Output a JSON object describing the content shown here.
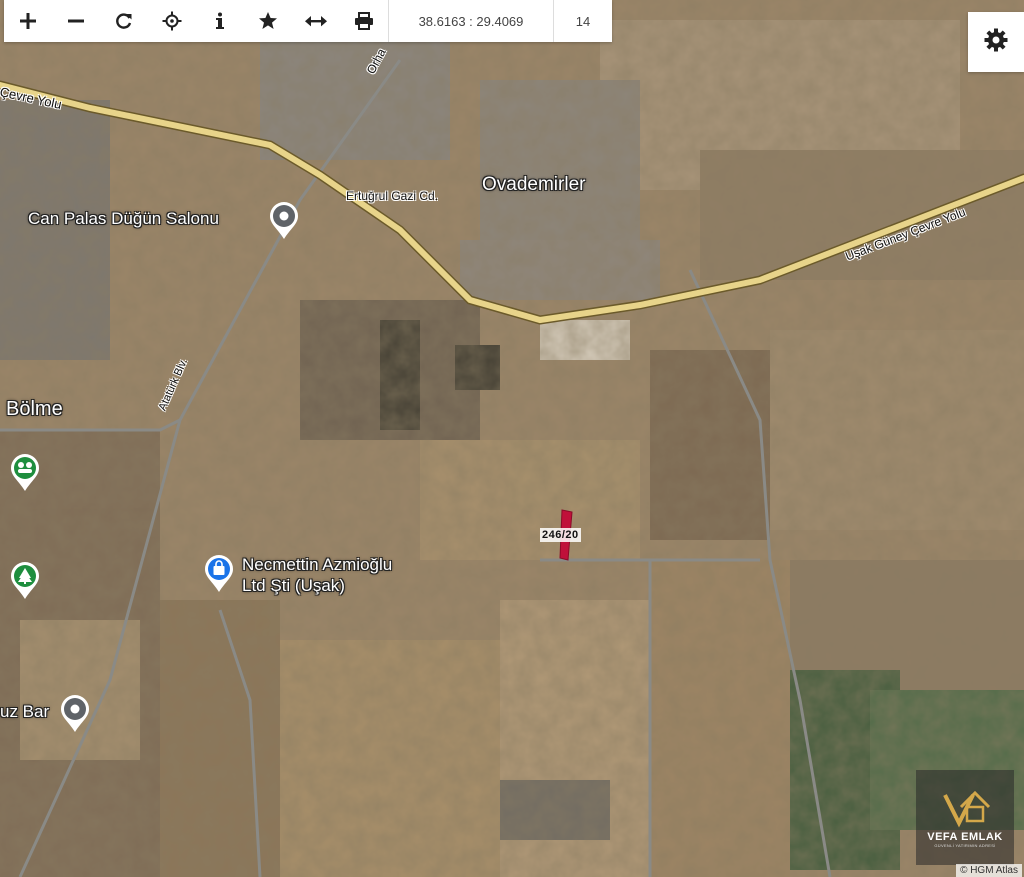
{
  "toolbar": {
    "buttons": [
      {
        "name": "zoom-in",
        "icon": "plus-icon"
      },
      {
        "name": "zoom-out",
        "icon": "minus-icon"
      },
      {
        "name": "refresh",
        "icon": "refresh-icon"
      },
      {
        "name": "locate",
        "icon": "crosshair-icon"
      },
      {
        "name": "info",
        "icon": "info-icon"
      },
      {
        "name": "favorite",
        "icon": "star-icon"
      },
      {
        "name": "measure",
        "icon": "arrows-horizontal-icon"
      },
      {
        "name": "print",
        "icon": "printer-icon"
      }
    ],
    "coordinates": "38.6163 : 29.4069",
    "zoom_level": "14"
  },
  "settings": {
    "icon": "gear-icon"
  },
  "labels": {
    "ovademirler": "Ovademirler",
    "bolme": "Bölme",
    "can_palas": "Can Palas Düğün Salonu",
    "necmettin_line1": "Necmettin Azmioğlu",
    "necmettin_line2": "Ltd Şti (Uşak)",
    "bar": "uz Bar"
  },
  "roads": {
    "cevre_yolu": "Çevre Yolu",
    "orha": "Orha",
    "ertugrul": "Ertuğrul Gazi Cd.",
    "usak_guney": "Uşak Güney Çevre Yolu",
    "ataturk": "Atatürk Blv."
  },
  "parcel": {
    "label": "246/20",
    "color": "#c0103a"
  },
  "watermark": {
    "name": "VEFA EMLAK",
    "tagline": "GÜVENLİ YATIRIMIN ADRESİ"
  },
  "attribution": "© HGM Atlas",
  "colors": {
    "road": "#e8d48a",
    "road_edge": "#6b5a2a",
    "pin": "#5f6368",
    "pin_green": "#1e8e3e",
    "pin_blue": "#1a73e8"
  }
}
